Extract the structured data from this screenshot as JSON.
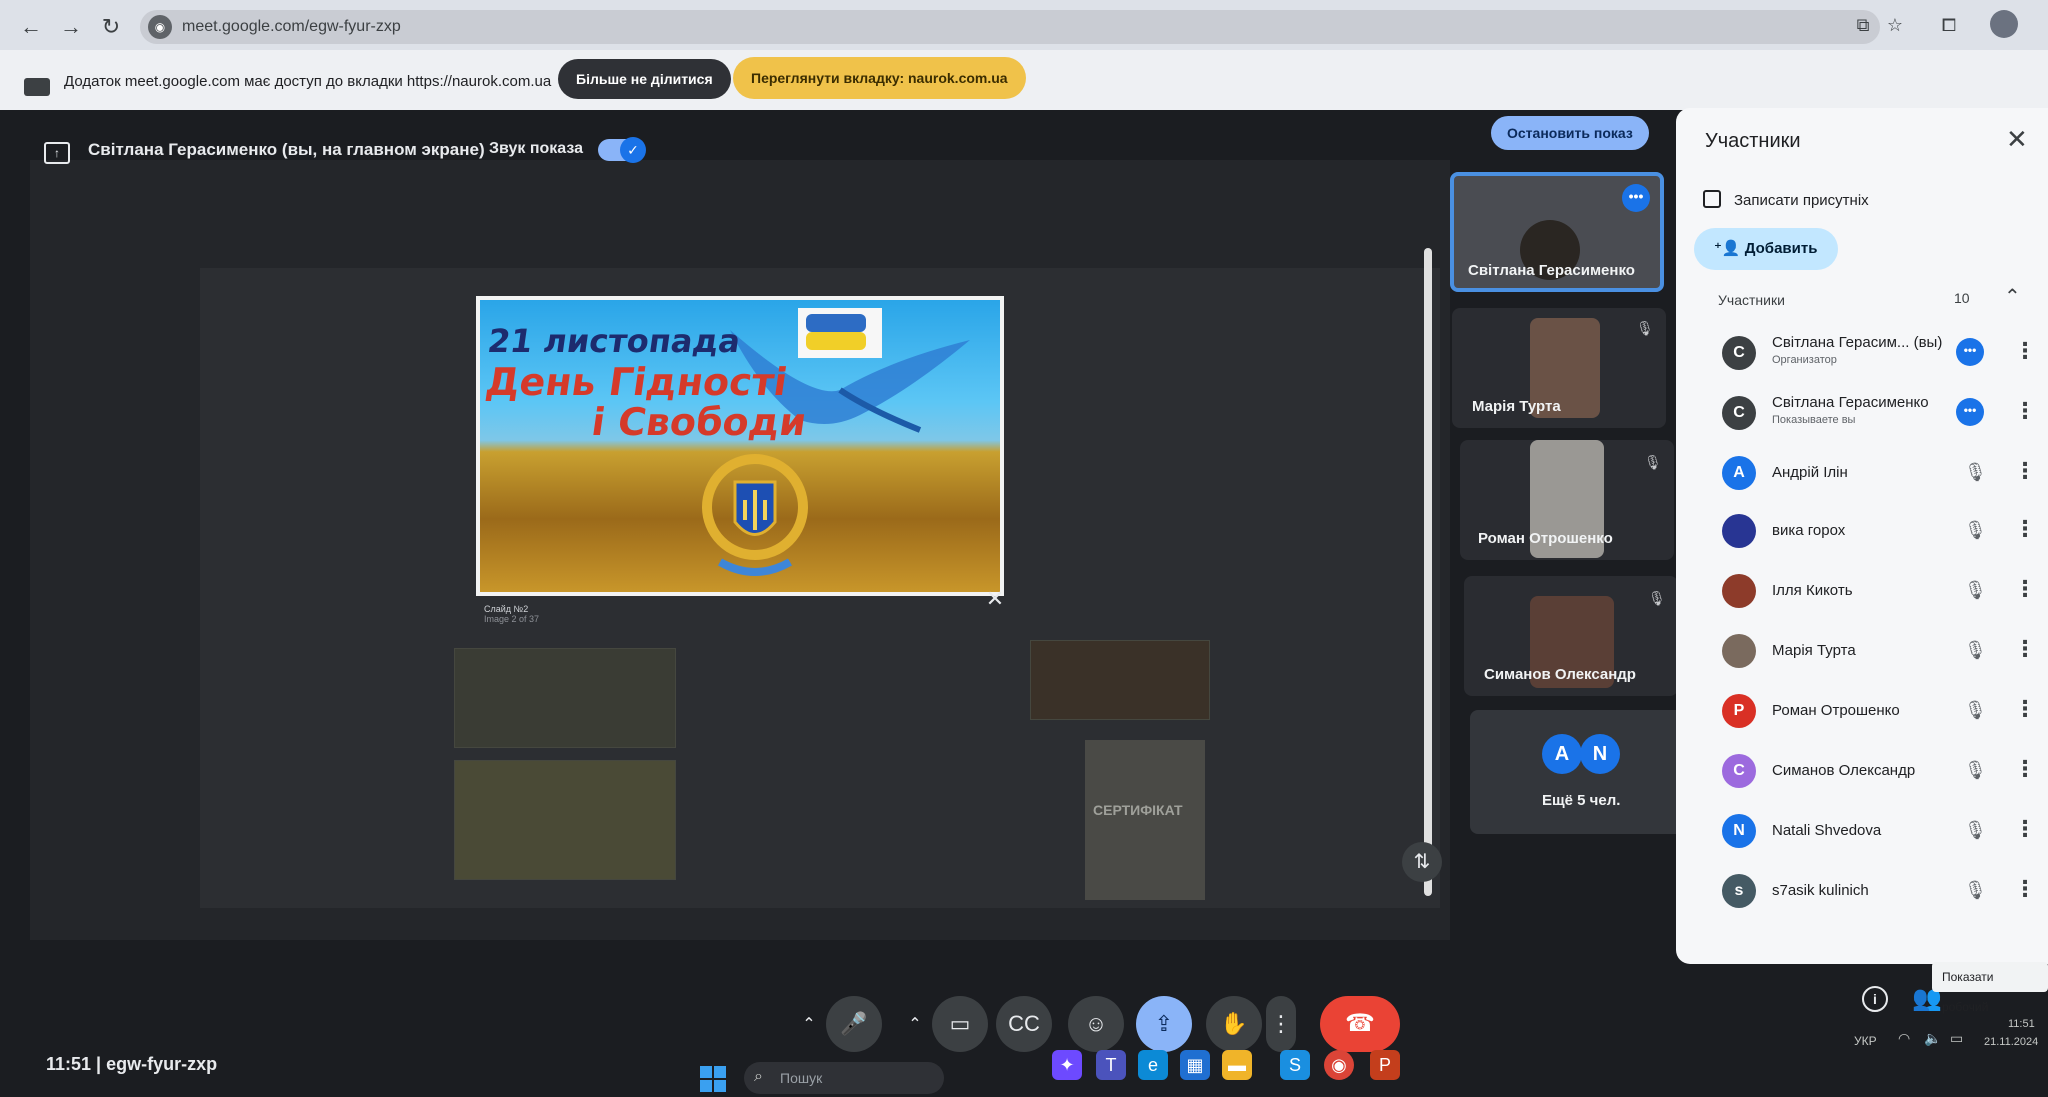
{
  "browser": {
    "url": "meet.google.com/egw-fyur-zxp"
  },
  "infobar": {
    "message": "Додаток meet.google.com має доступ до вкладки https://naurok.com.ua",
    "stop_sharing": "Більше не ділитися",
    "switch_tab": "Переглянути вкладку: naurok.com.ua"
  },
  "meet_header": {
    "presenter": "Світлана Герасименко (вы, на главном экране)",
    "sound_label": "Звук показа",
    "stop_presenting": "Остановить показ"
  },
  "slide": {
    "line1": "21 листопада",
    "line2": "День Гідності",
    "line3": "і Свободи",
    "caption": "Слайд №2",
    "subcaption": "Image 2 of 37"
  },
  "shared_screen": {
    "certificate": "СЕРТИФІКАТ"
  },
  "tiles": {
    "t1": "Світлана Герасименко",
    "t2": "Марія Турта",
    "t3": "Роман Отрошенко",
    "t4": "Симанов Олександр",
    "more_a": "A",
    "more_n": "N",
    "more_label": "Ещё 5 чел."
  },
  "panel": {
    "title": "Участники",
    "record": "Записати присутніх",
    "add": "Добавить",
    "section": "Участники",
    "count": "10",
    "people": [
      {
        "initial": "С",
        "name": "Світлана Герасим...  (вы)",
        "sub": "Организатор",
        "color": "#3c4043"
      },
      {
        "initial": "С",
        "name": "Світлана Герасименко",
        "sub": "Показываете вы",
        "color": "#3c4043"
      },
      {
        "initial": "А",
        "name": "Андрій Ілін",
        "sub": "",
        "color": "#1a73e8"
      },
      {
        "initial": "",
        "name": "вика горох",
        "sub": "",
        "color": "#283593"
      },
      {
        "initial": "",
        "name": "Ілля Кикоть",
        "sub": "",
        "color": "#8d3b2a"
      },
      {
        "initial": "",
        "name": "Марія Турта",
        "sub": "",
        "color": "#7a6a5e"
      },
      {
        "initial": "Р",
        "name": "Роман Отрошенко",
        "sub": "",
        "color": "#d93025"
      },
      {
        "initial": "С",
        "name": "Симанов Олександр",
        "sub": "",
        "color": "#9c6ade"
      },
      {
        "initial": "N",
        "name": "Natali Shvedova",
        "sub": "",
        "color": "#1a73e8"
      },
      {
        "initial": "s",
        "name": "s7asik kulinich",
        "sub": "",
        "color": "#455a64"
      }
    ]
  },
  "controls": {
    "meet_code": "11:51  |  egw-fyur-zxp",
    "tooltip": "Показати робочий"
  },
  "taskbar": {
    "search": "Пошук",
    "lang": "УКР",
    "time": "11:51",
    "date": "21.11.2024"
  }
}
